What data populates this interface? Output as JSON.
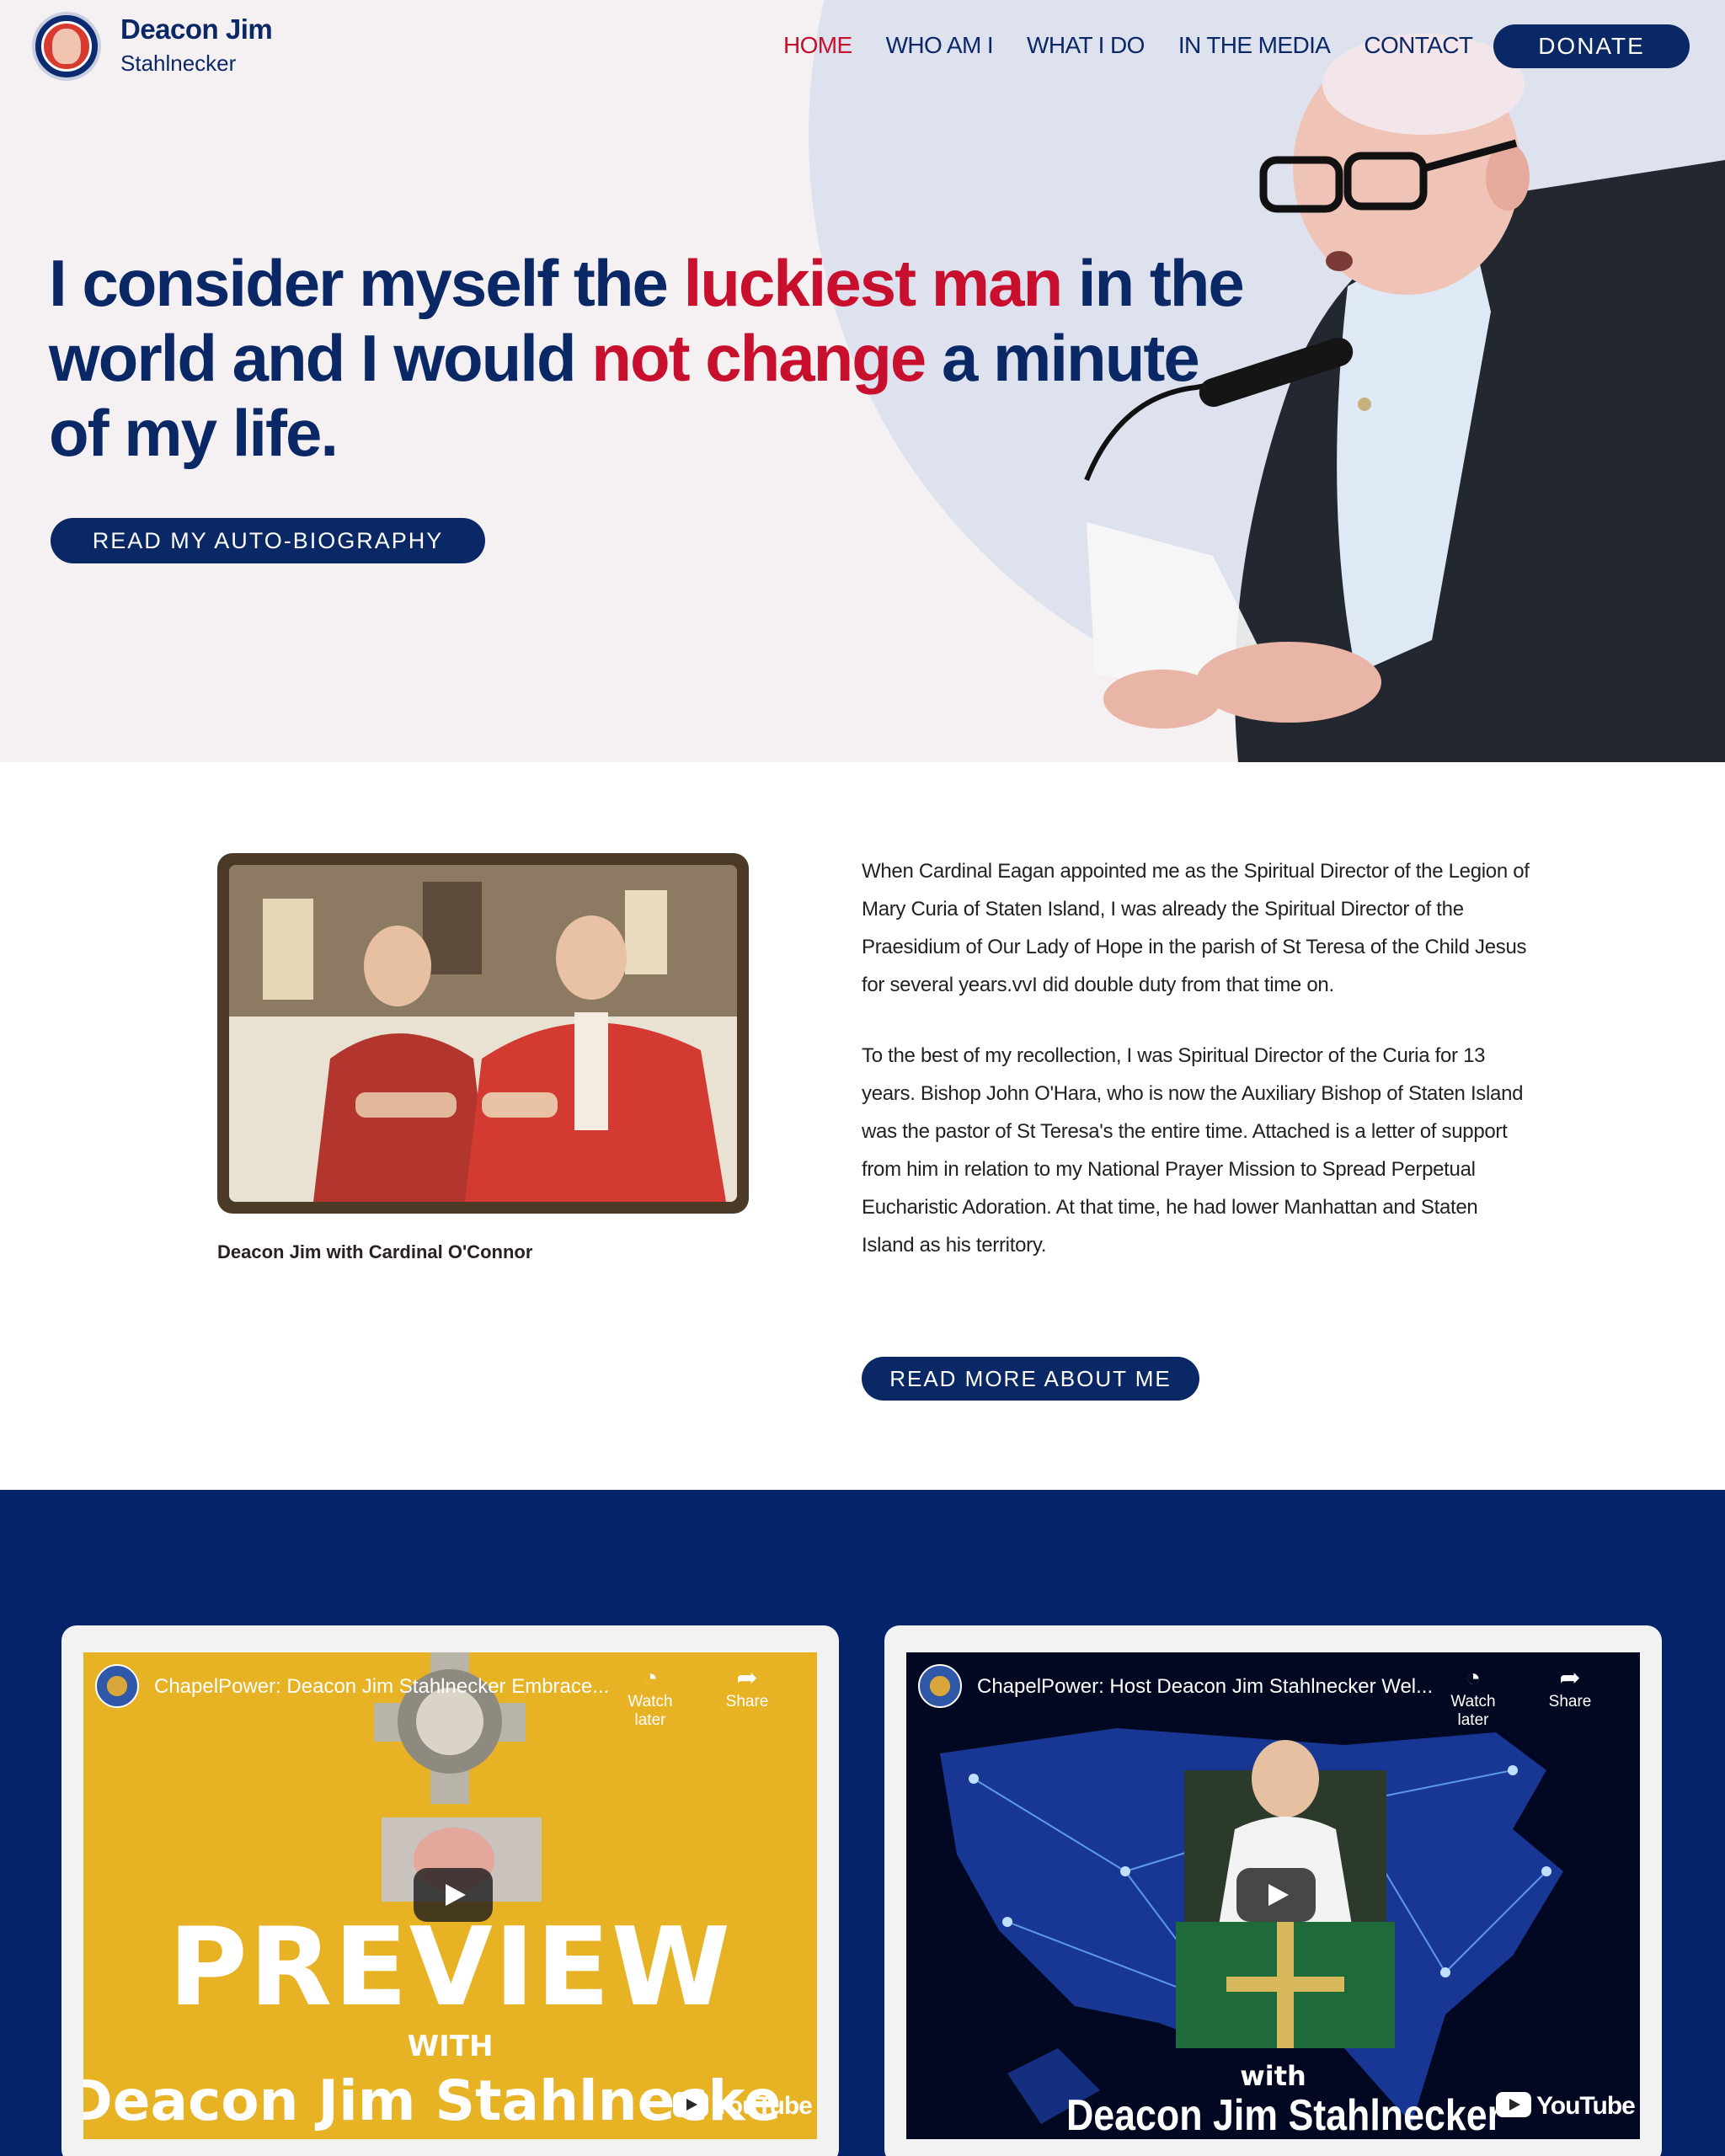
{
  "brand": {
    "name": "Deacon Jim",
    "subtitle": "Stahlnecker"
  },
  "nav": {
    "items": [
      {
        "label": "HOME",
        "active": true
      },
      {
        "label": "WHO AM I",
        "active": false
      },
      {
        "label": "WHAT I DO",
        "active": false
      },
      {
        "label": "IN THE MEDIA",
        "active": false
      },
      {
        "label": "CONTACT",
        "active": false
      }
    ],
    "donate_label": "DONATE"
  },
  "hero": {
    "headline_1": "I consider myself the ",
    "headline_2": "luckiest man",
    "headline_3": " in the world and I would ",
    "headline_4": "not change",
    "headline_5": " a minute of my life.",
    "cta_label": "READ MY AUTO-BIOGRAPHY"
  },
  "about": {
    "photo_caption": "Deacon Jim with Cardinal O'Connor",
    "paragraph_1": "When Cardinal Eagan appointed me as the Spiritual Director of the Legion of Mary Curia of Staten Island, I was already the Spiritual Director of the Praesidium of Our Lady of Hope in the parish of St Teresa of the Child Jesus for several years.vvI did double duty from that time on.",
    "paragraph_2": "To the best of my recollection, I was Spiritual Director of the Curia for 13 years.  Bishop John O'Hara, who is now the Auxiliary Bishop of Staten Island was the pastor of St Teresa's the entire time. Attached is a letter of support from him in relation to my National Prayer Mission to Spread Perpetual Eucharistic Adoration.  At that time, he had lower Manhattan and Staten Island as his territory.",
    "cta_label": "READ MORE ABOUT ME"
  },
  "videos": [
    {
      "title": "ChapelPower: Deacon Jim Stahlnecker Embrace...",
      "watch_later": "Watch later",
      "share": "Share",
      "big_text": "PREVIEW",
      "with_text": "WITH",
      "name_text": "Deacon Jim Stahlnecke",
      "youtube": "YouTube"
    },
    {
      "title": "ChapelPower: Host Deacon Jim Stahlnecker Wel...",
      "watch_later": "Watch later",
      "share": "Share",
      "with_text": "with",
      "name_text": "Deacon Jim Stahlnecker",
      "youtube": "YouTube"
    }
  ],
  "colors": {
    "navy": "#0b2866",
    "red": "#c8102e",
    "hero_bg": "#f5f1f3",
    "video_section_bg": "#05236b"
  },
  "icons": [
    "logo-emblem",
    "watch-later-clock-icon",
    "share-arrow-icon",
    "play-icon",
    "youtube-logo-icon"
  ]
}
